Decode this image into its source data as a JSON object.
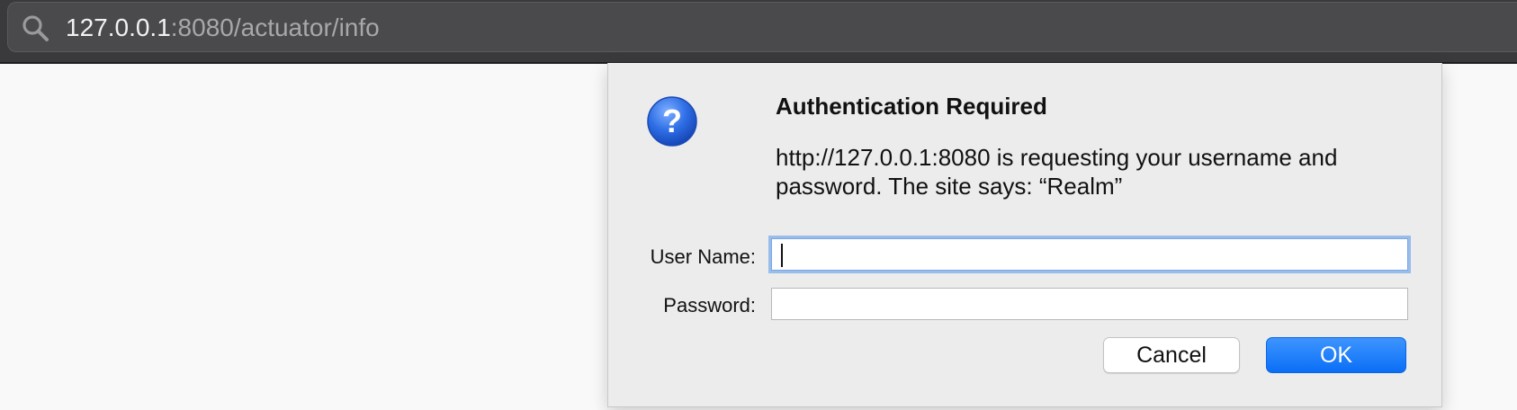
{
  "browser": {
    "url_host": "127.0.0.1",
    "url_path": ":8080/actuator/info",
    "search_icon": "magnifier-icon"
  },
  "dialog": {
    "icon": "question-mark-icon",
    "icon_color": "#2f6fe6",
    "title": "Authentication Required",
    "message": "http://127.0.0.1:8080 is requesting your username and password. The site says: “Realm”",
    "username_label": "User Name:",
    "username_value": "",
    "password_label": "Password:",
    "password_value": "",
    "cancel_label": "Cancel",
    "ok_label": "OK",
    "ok_color": "#1a7bff"
  }
}
